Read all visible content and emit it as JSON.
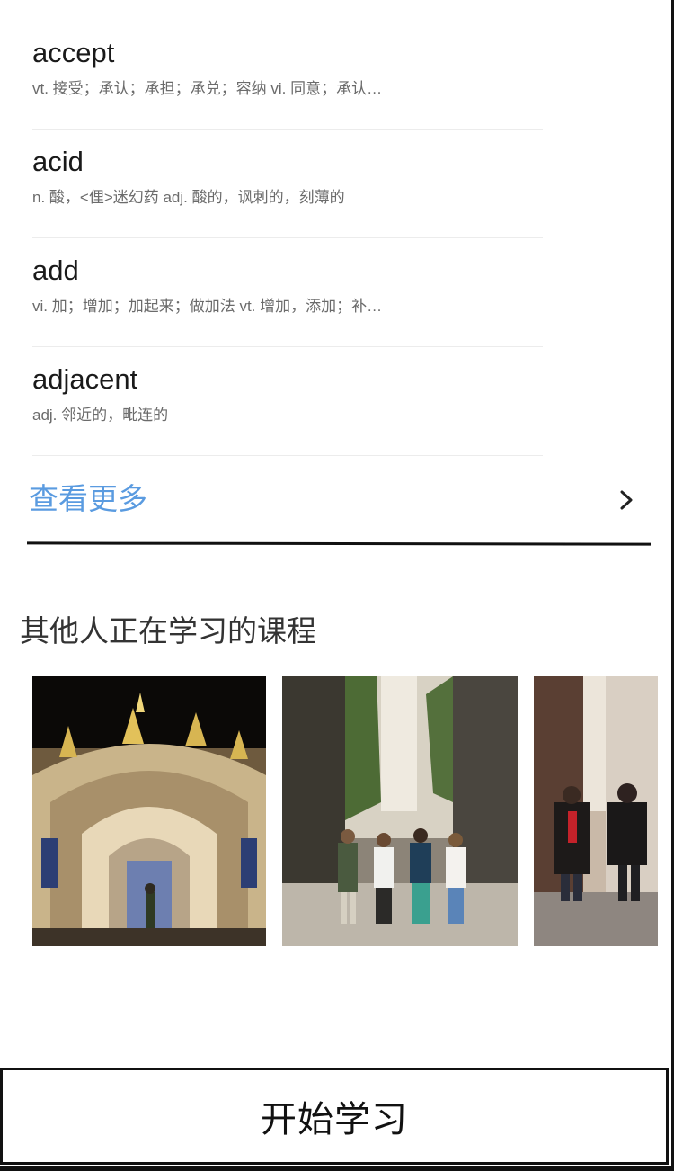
{
  "words": [
    {
      "term": "accept",
      "definition": "vt. 接受；承认；承担；承兑；容纳 vi. 同意；承认…"
    },
    {
      "term": "acid",
      "definition": "n. 酸，<俚>迷幻药 adj. 酸的，讽刺的，刻薄的"
    },
    {
      "term": "add",
      "definition": "vi. 加；增加；加起来；做加法 vt. 增加，添加；补…"
    },
    {
      "term": "adjacent",
      "definition": "adj. 邻近的，毗连的"
    }
  ],
  "see_more": {
    "label": "查看更多",
    "icon": "chevron-right-icon",
    "color": "#5a9be0"
  },
  "other_courses": {
    "title": "其他人正在学习的课程",
    "cards": [
      {
        "image": "ornate-church-facade-at-night"
      },
      {
        "image": "friends-walking-in-narrow-street"
      },
      {
        "image": "couple-walking-in-old-town-street"
      }
    ]
  },
  "start_button": {
    "label": "开始学习"
  }
}
